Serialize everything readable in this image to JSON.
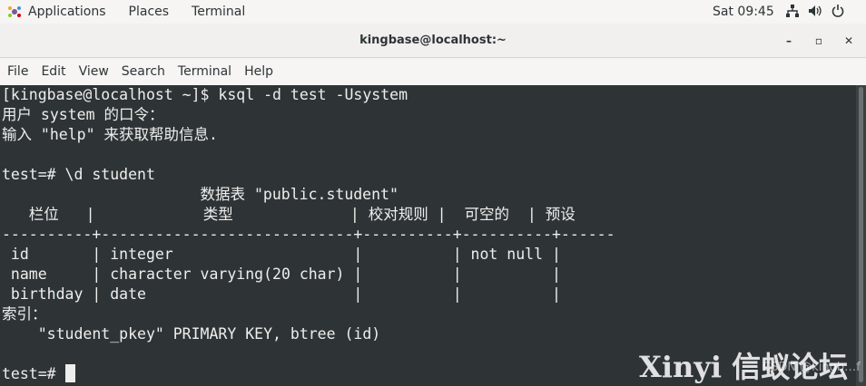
{
  "topbar": {
    "applications": "Applications",
    "places": "Places",
    "terminal": "Terminal",
    "clock": "Sat 09:45"
  },
  "window": {
    "title": "kingbase@localhost:~",
    "minimize": "–",
    "maximize": "▫",
    "close": "✕"
  },
  "menubar": [
    "File",
    "Edit",
    "View",
    "Search",
    "Terminal",
    "Help"
  ],
  "terminal_lines": [
    "[kingbase@localhost ~]$ ksql -d test -Usystem",
    "用户 system 的口令：",
    "输入 \"help\" 来获取帮助信息.",
    "",
    "test=# \\d student",
    "                      数据表 \"public.student\"",
    "   栏位   |            类型             | 校对规则 |  可空的  | 预设",
    "----------+----------------------------+----------+----------+------",
    " id       | integer                    |          | not null |",
    " name     | character varying(20 char) |          |          |",
    " birthday | date                       |          |          |",
    "索引：",
    "    \"student_pkey\" PRIMARY KEY, btree (id)",
    "",
    "test=# "
  ],
  "watermark": {
    "text": "Xinyi 信蚁论坛",
    "sub": "CSDN @kingb…f"
  }
}
